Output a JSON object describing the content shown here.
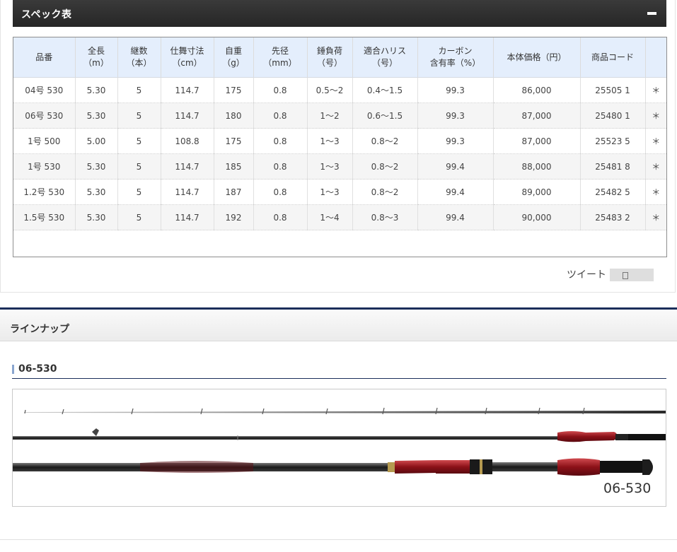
{
  "spec": {
    "title": "スペック表",
    "columns": [
      [
        "品番",
        ""
      ],
      [
        "全長",
        "（m）"
      ],
      [
        "継数",
        "（本）"
      ],
      [
        "仕舞寸法",
        "（cm）"
      ],
      [
        "自重",
        "（g）"
      ],
      [
        "先径",
        "（mm）"
      ],
      [
        "錘負荷",
        "（号）"
      ],
      [
        "適合ハリス",
        "（号）"
      ],
      [
        "カーボン",
        "含有率（%）"
      ],
      [
        "本体価格（円）",
        ""
      ],
      [
        "商品コード",
        ""
      ],
      [
        "",
        ""
      ]
    ],
    "rows": [
      [
        "04号 530",
        "5.30",
        "5",
        "114.7",
        "175",
        "0.8",
        "0.5〜2",
        "0.4〜1.5",
        "99.3",
        "86,000",
        "25505 1",
        "＊"
      ],
      [
        "06号 530",
        "5.30",
        "5",
        "114.7",
        "180",
        "0.8",
        "1〜2",
        "0.6〜1.5",
        "99.3",
        "87,000",
        "25480 1",
        "＊"
      ],
      [
        "1号 500",
        "5.00",
        "5",
        "108.8",
        "175",
        "0.8",
        "1〜3",
        "0.8〜2",
        "99.3",
        "87,000",
        "25523 5",
        "＊"
      ],
      [
        "1号 530",
        "5.30",
        "5",
        "114.7",
        "185",
        "0.8",
        "1〜3",
        "0.8〜2",
        "99.4",
        "88,000",
        "25481 8",
        "＊"
      ],
      [
        "1.2号 530",
        "5.30",
        "5",
        "114.7",
        "187",
        "0.8",
        "1〜3",
        "0.8〜2",
        "99.4",
        "89,000",
        "25482 5",
        "＊"
      ],
      [
        "1.5号 530",
        "5.30",
        "5",
        "114.7",
        "192",
        "0.8",
        "1〜4",
        "0.8〜3",
        "99.4",
        "90,000",
        "25483 2",
        "＊"
      ]
    ]
  },
  "social": {
    "tweet_label": "ツイート"
  },
  "lineup": {
    "title": "ラインナップ",
    "model_name": "06-530",
    "image_code": "06-530"
  },
  "colors": {
    "header_dark": "#2b2b2b",
    "table_header": "#e4eefc",
    "accent_navy": "#1b2e5a",
    "rod_red": "#9e1b22"
  }
}
